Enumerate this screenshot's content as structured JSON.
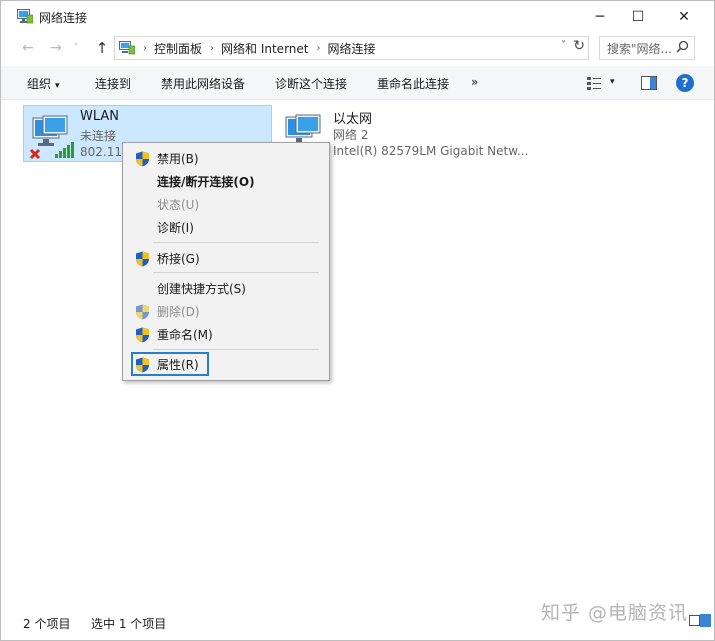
{
  "window": {
    "title": "网络连接",
    "minimize_glyph": "─",
    "maximize_glyph": "☐",
    "close_glyph": "✕"
  },
  "nav": {
    "back_glyph": "←",
    "forward_glyph": "→",
    "history_glyph": "˅",
    "up_glyph": "↑"
  },
  "address": {
    "crumbs": [
      "控制面板",
      "网络和 Internet",
      "网络连接"
    ],
    "separator": "›",
    "dropdown_glyph": "˅",
    "refresh_glyph": "↻"
  },
  "search": {
    "placeholder": "搜索\"网络...",
    "icon": "search-icon"
  },
  "toolbar": {
    "organize": "组织",
    "connect": "连接到",
    "disable": "禁用此网络设备",
    "diagnose": "诊断这个连接",
    "rename": "重命名此连接",
    "more": "»",
    "dropdown_arrow": "▾",
    "help": "?"
  },
  "items": [
    {
      "name": "WLAN",
      "status": "未连接",
      "device": "802.11n",
      "selected": true,
      "icon": "wireless-network-icon",
      "disconnected": true
    },
    {
      "name": "以太网",
      "status": "网络 2",
      "device": "Intel(R) 82579LM Gigabit Netw...",
      "selected": false,
      "icon": "ethernet-network-icon"
    }
  ],
  "context_menu": {
    "items": [
      {
        "label": "禁用(B)",
        "shield": true,
        "bold": false,
        "disabled": false
      },
      {
        "label": "连接/断开连接(O)",
        "shield": false,
        "bold": true,
        "disabled": false
      },
      {
        "label": "状态(U)",
        "shield": false,
        "bold": false,
        "disabled": true
      },
      {
        "label": "诊断(I)",
        "shield": false,
        "bold": false,
        "disabled": false
      },
      {
        "label": "桥接(G)",
        "shield": true,
        "bold": false,
        "disabled": false
      },
      {
        "label": "创建快捷方式(S)",
        "shield": false,
        "bold": false,
        "disabled": false
      },
      {
        "label": "删除(D)",
        "shield": true,
        "bold": false,
        "disabled": true
      },
      {
        "label": "重命名(M)",
        "shield": true,
        "bold": false,
        "disabled": false
      },
      {
        "label": "属性(R)",
        "shield": true,
        "bold": false,
        "disabled": false,
        "focused": true
      }
    ]
  },
  "status": {
    "count": "2 个项目",
    "selected": "选中 1 个项目"
  },
  "watermark": "知乎 @电脑资讯",
  "colors": {
    "selection_bg": "#cce8ff",
    "selection_border": "#99d1ff",
    "accent": "#1e6fd0",
    "focus_outline": "#2a7fc9"
  }
}
